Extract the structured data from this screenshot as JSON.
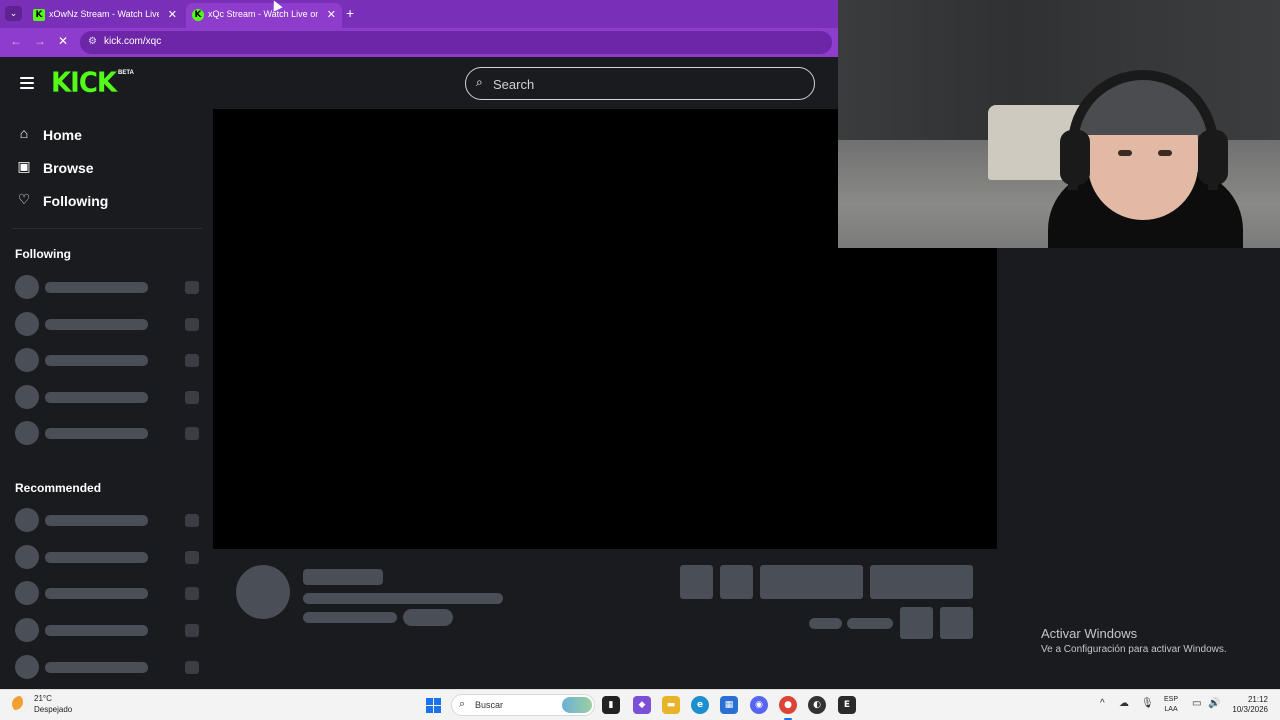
{
  "browser": {
    "tabs": [
      {
        "title": "xOwNz Stream - Watch Live on Kick",
        "favicon": "K",
        "active": false
      },
      {
        "title": "xQc Stream - Watch Live on Kick",
        "favicon": "K",
        "active": true
      }
    ],
    "close_glyph": "✕",
    "new_tab_glyph": "+",
    "url": "kick.com/xqc",
    "tab_menu_glyph": "⌄",
    "back_glyph": "←",
    "forward_glyph": "→",
    "reload_glyph": "✕",
    "site_info_glyph": "⚙",
    "theme_color": "#7a2fb8"
  },
  "site": {
    "logo_text": "KICK",
    "logo_badge": "BETA",
    "brand_color": "#53fc18",
    "search_placeholder": "Search",
    "search_glyph": "⌕",
    "menu_icon": "hamburger-icon",
    "nav": [
      {
        "label": "Home",
        "icon": "home-icon",
        "glyph": "⌂"
      },
      {
        "label": "Browse",
        "icon": "browse-icon",
        "glyph": "▣"
      },
      {
        "label": "Following",
        "icon": "heart-icon",
        "glyph": "♡"
      }
    ],
    "sections": {
      "following_title": "Following",
      "recommended_title": "Recommended"
    }
  },
  "overlay": {
    "activate_title": "Activar Windows",
    "activate_sub": "Ve a Configuración para activar Windows."
  },
  "taskbar": {
    "weather_temp": "21°C",
    "weather_desc": "Despejado",
    "search_label": "Buscar",
    "search_glyph": "⌕",
    "lang_line1": "ESP",
    "lang_line2": "LAA",
    "time": "21:12",
    "date": "10/3/2026",
    "tray_glyphs": {
      "chevron": "^",
      "cloud": "☁",
      "mic": "🎙",
      "display": "▭",
      "volume": "🔊"
    },
    "apps": [
      {
        "name": "file-explorer-icon",
        "glyph": "▮",
        "color": "#222222"
      },
      {
        "name": "copilot-icon",
        "glyph": "◆",
        "color": "#7b4fd6"
      },
      {
        "name": "folder-icon",
        "glyph": "▬",
        "color": "#e8b52a"
      },
      {
        "name": "edge-icon",
        "glyph": "e",
        "color": "#1b8fd0"
      },
      {
        "name": "store-icon",
        "glyph": "▦",
        "color": "#2a6fd4"
      },
      {
        "name": "discord-icon",
        "glyph": "◉",
        "color": "#5865f2"
      },
      {
        "name": "chrome-icon",
        "glyph": "●",
        "color": "#db4437"
      },
      {
        "name": "app-icon",
        "glyph": "◐",
        "color": "#333333"
      },
      {
        "name": "epic-games-icon",
        "glyph": "E",
        "color": "#2a2a2a"
      }
    ]
  }
}
